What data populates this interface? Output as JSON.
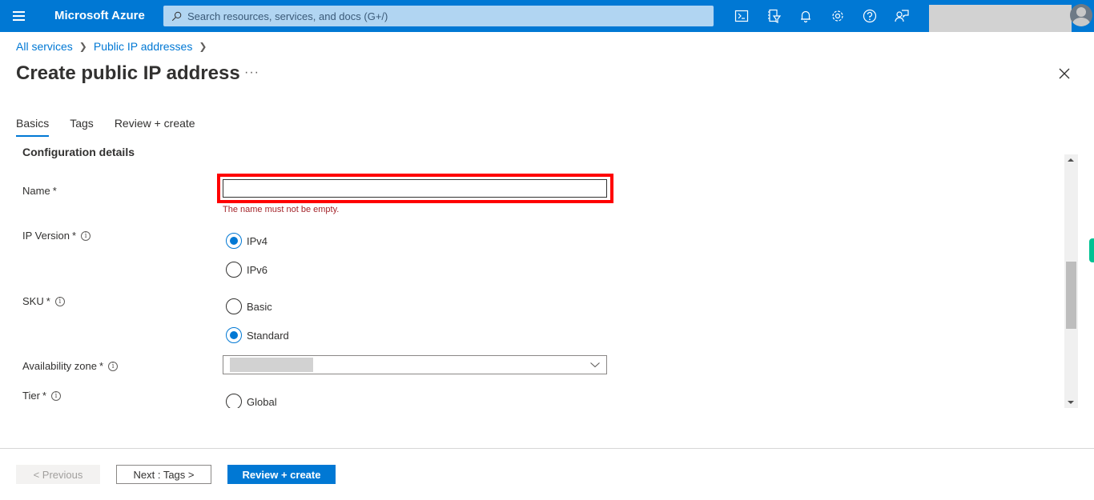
{
  "topbar": {
    "brand": "Microsoft Azure",
    "search_placeholder": "Search resources, services, and docs (G+/)",
    "icons": [
      "cloud-shell-icon",
      "directory-filter-icon",
      "notifications-bell-icon",
      "settings-gear-icon",
      "help-question-icon",
      "feedback-icon"
    ],
    "brand_color": "#0078d4"
  },
  "breadcrumb": {
    "items": [
      "All services",
      "Public IP addresses"
    ]
  },
  "page": {
    "title": "Create public IP address",
    "more_label": "···"
  },
  "tabs": [
    {
      "label": "Basics",
      "active": true
    },
    {
      "label": "Tags",
      "active": false
    },
    {
      "label": "Review + create",
      "active": false
    }
  ],
  "form": {
    "section_heading": "Configuration details",
    "name": {
      "label": "Name",
      "required": "*",
      "value": "",
      "error": "The name must not be empty."
    },
    "ip_version": {
      "label": "IP Version",
      "required": "*",
      "options": [
        {
          "label": "IPv4",
          "checked": true
        },
        {
          "label": "IPv6",
          "checked": false
        }
      ]
    },
    "sku": {
      "label": "SKU",
      "required": "*",
      "options": [
        {
          "label": "Basic",
          "checked": false
        },
        {
          "label": "Standard",
          "checked": true
        }
      ]
    },
    "availability_zone": {
      "label": "Availability zone",
      "required": "*",
      "value": ""
    },
    "tier": {
      "label": "Tier",
      "required": "*",
      "options": [
        {
          "label": "Global",
          "checked": false
        }
      ]
    }
  },
  "footer": {
    "previous": "< Previous",
    "next": "Next : Tags >",
    "review": "Review + create"
  }
}
